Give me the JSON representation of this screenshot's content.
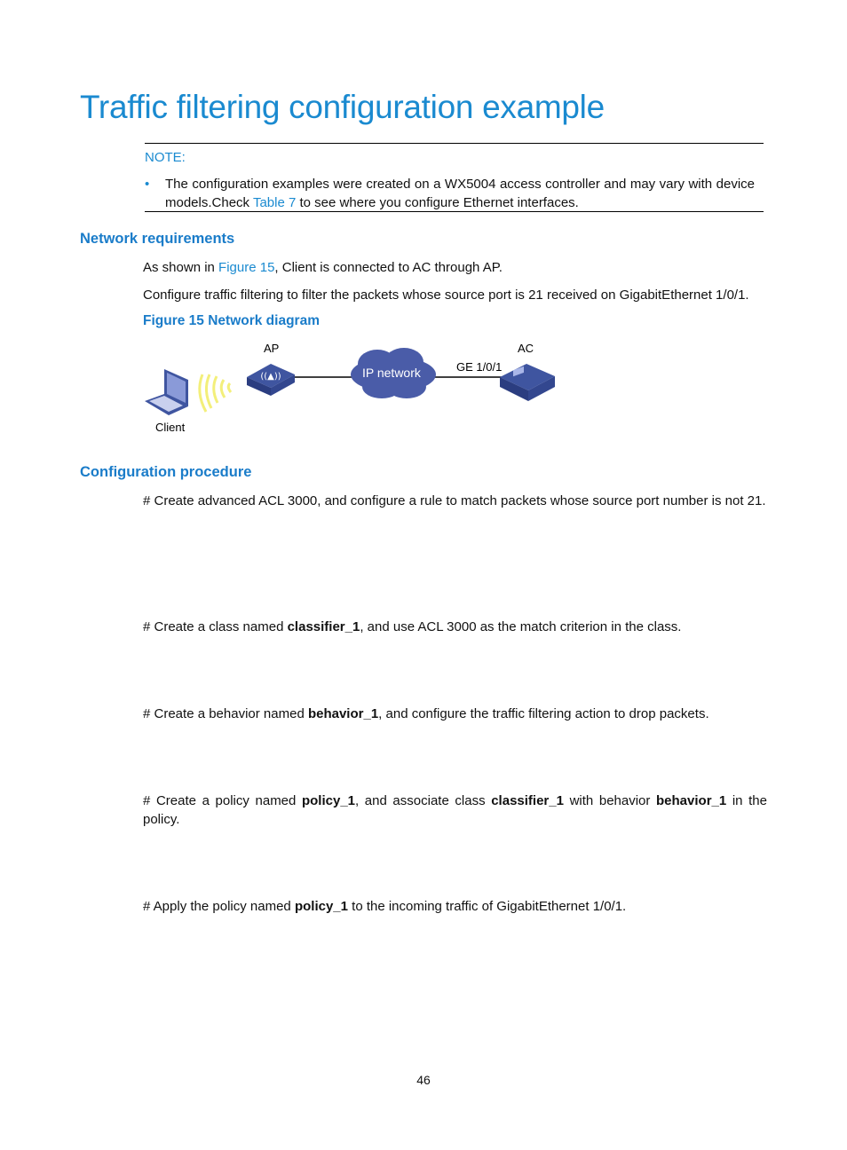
{
  "title": "Traffic filtering configuration example",
  "note": {
    "label": "NOTE:",
    "text_before": "The configuration examples were created on a WX5004 access controller and may vary with device models.Check ",
    "link": "Table 7",
    "text_after": " to see where you configure Ethernet interfaces."
  },
  "network_requirements": {
    "heading": "Network requirements",
    "p1_before": "As shown in ",
    "p1_link": "Figure 15",
    "p1_after": ", Client is connected to AC through AP.",
    "p2": "Configure traffic filtering to filter the packets whose source port is 21 received on GigabitEthernet 1/0/1.",
    "figure_caption": "Figure 15 Network diagram"
  },
  "diagram": {
    "client": "Client",
    "ap": "AP",
    "cloud": "IP network",
    "ac": "AC",
    "port": "GE 1/0/1",
    "colors": {
      "device": "#3f55a0",
      "cloud": "#4a5ca8",
      "wireless": "#f3ef7a"
    }
  },
  "procedure": {
    "heading": "Configuration procedure",
    "step1": "# Create advanced ACL 3000, and configure a rule to match packets whose source port number is not 21.",
    "step2": {
      "a": "# Create a class named ",
      "b": "classifier_1",
      "c": ", and use ACL 3000 as the match criterion in the class."
    },
    "step3": {
      "a": "# Create a behavior named ",
      "b": "behavior_1",
      "c": ", and configure the traffic filtering action to drop packets."
    },
    "step4": {
      "a": "# Create a policy named ",
      "b": "policy_1",
      "c": ", and associate class ",
      "d": "classifier_1",
      "e": " with behavior ",
      "f": "behavior_1",
      "g": " in the policy."
    },
    "step5": {
      "a": "# Apply the policy named ",
      "b": "policy_1",
      "c": " to the incoming traffic of GigabitEthernet 1/0/1."
    }
  },
  "page_number": "46"
}
